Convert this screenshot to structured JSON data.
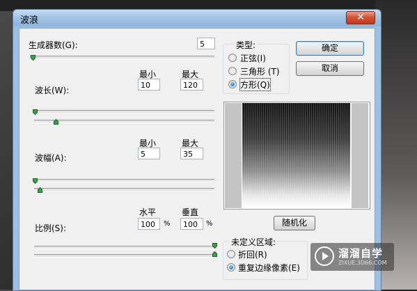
{
  "window": {
    "title": "波浪",
    "close_glyph": "✕"
  },
  "generators": {
    "label": "生成器数(G):",
    "value": "5"
  },
  "wavelength": {
    "label": "波长(W):",
    "min_label": "最小",
    "max_label": "最大",
    "min_value": "10",
    "max_value": "120"
  },
  "amplitude": {
    "label": "波幅(A):",
    "min_label": "最小",
    "max_label": "最大",
    "min_value": "5",
    "max_value": "35"
  },
  "scale": {
    "label": "比例(S):",
    "h_label": "水平",
    "v_label": "垂直",
    "h_value": "100",
    "v_value": "100",
    "percent": "%"
  },
  "type_group": {
    "title": "类型:",
    "options": [
      {
        "label": "正弦(I)",
        "selected": false
      },
      {
        "label": "三角形 (T)",
        "selected": false
      },
      {
        "label": "方形(Q)",
        "selected": true
      }
    ]
  },
  "buttons": {
    "ok": "确定",
    "cancel": "取消",
    "randomize": "随机化"
  },
  "undefined_area": {
    "title": "未定义区域:",
    "options": [
      {
        "label": "折回(R)",
        "selected": false
      },
      {
        "label": "重复边缘像素(E)",
        "selected": true
      }
    ]
  },
  "watermark": {
    "name": "溜溜自学",
    "url": "ZIXUE.3D66.COM"
  },
  "colors": {
    "title_bar": "#9cbfe2",
    "close_button": "#c8452b",
    "dialog_bg": "#f0f0f0",
    "radio_selected": "#1a6fc4"
  },
  "icons": {
    "close": "close-icon",
    "slider_thumb": "slider-thumb-icon",
    "watermark_logo": "play-logo-icon"
  }
}
